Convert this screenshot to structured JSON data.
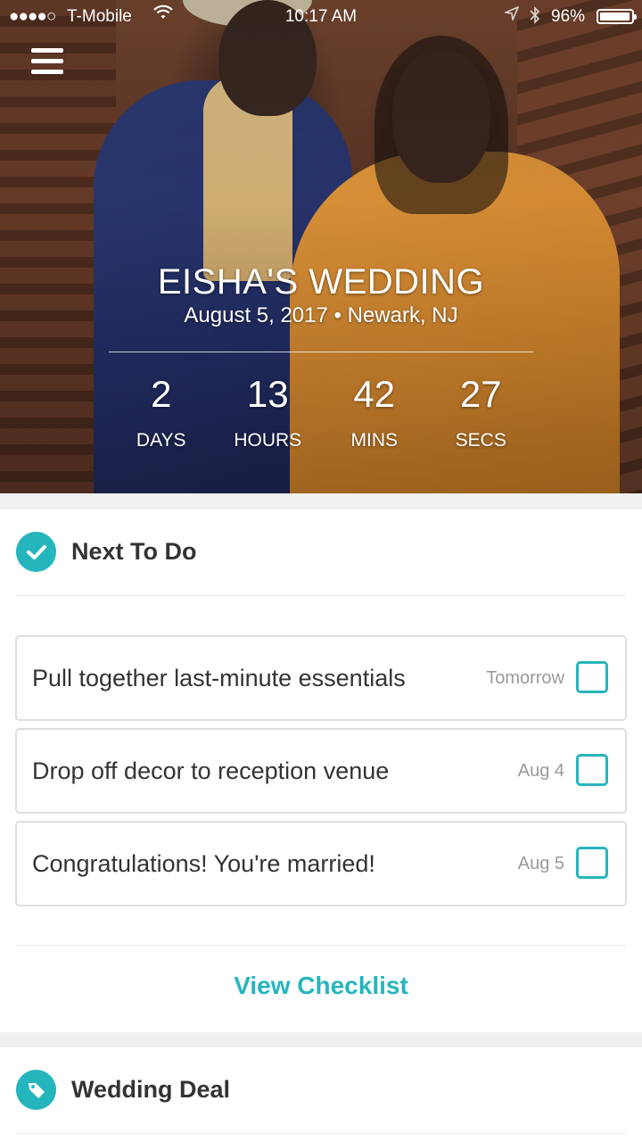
{
  "status_bar": {
    "signal": "●●●●○",
    "carrier": "T-Mobile",
    "time": "10:17 AM",
    "battery_percent": "96%",
    "battery_level": 0.96,
    "icons": [
      "wifi-icon",
      "location-icon",
      "bluetooth-icon",
      "battery-icon"
    ]
  },
  "header": {
    "menu_icon": "hamburger-menu-icon",
    "title": "EISHA'S WEDDING",
    "subtitle": "August 5, 2017 • Newark, NJ"
  },
  "countdown": [
    {
      "value": "2",
      "label": "DAYS"
    },
    {
      "value": "13",
      "label": "HOURS"
    },
    {
      "value": "42",
      "label": "MINS"
    },
    {
      "value": "27",
      "label": "SECS"
    }
  ],
  "next_to_do": {
    "icon": "checkmark-circle-icon",
    "title": "Next To Do",
    "items": [
      {
        "task": "Pull together last-minute essentials",
        "due": "Tomorrow",
        "checked": false
      },
      {
        "task": "Drop off decor to reception venue",
        "due": "Aug 4",
        "checked": false
      },
      {
        "task": "Congratulations! You're married!",
        "due": "Aug 5",
        "checked": false
      }
    ],
    "view_checklist_label": "View Checklist"
  },
  "wedding_deal": {
    "icon": "tag-icon",
    "title": "Wedding Deal"
  },
  "colors": {
    "accent": "#25b5bd",
    "text": "#333333",
    "muted": "#9a9a9a"
  }
}
